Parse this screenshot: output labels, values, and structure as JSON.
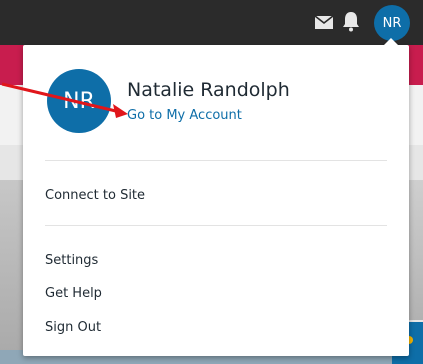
{
  "topbar": {
    "avatar_initials": "NR",
    "icons": [
      "mail-icon",
      "bell-icon"
    ]
  },
  "account_menu": {
    "avatar_initials": "NR",
    "user_name": "Natalie Randolph",
    "account_link": "Go to My Account",
    "items": [
      {
        "label": "Connect to Site"
      },
      {
        "label": "Settings"
      },
      {
        "label": "Get Help"
      },
      {
        "label": "Sign Out"
      }
    ]
  },
  "colors": {
    "accent": "#0e6ea8",
    "topbar": "#2b2b2b",
    "annotation": "#e0161b"
  }
}
